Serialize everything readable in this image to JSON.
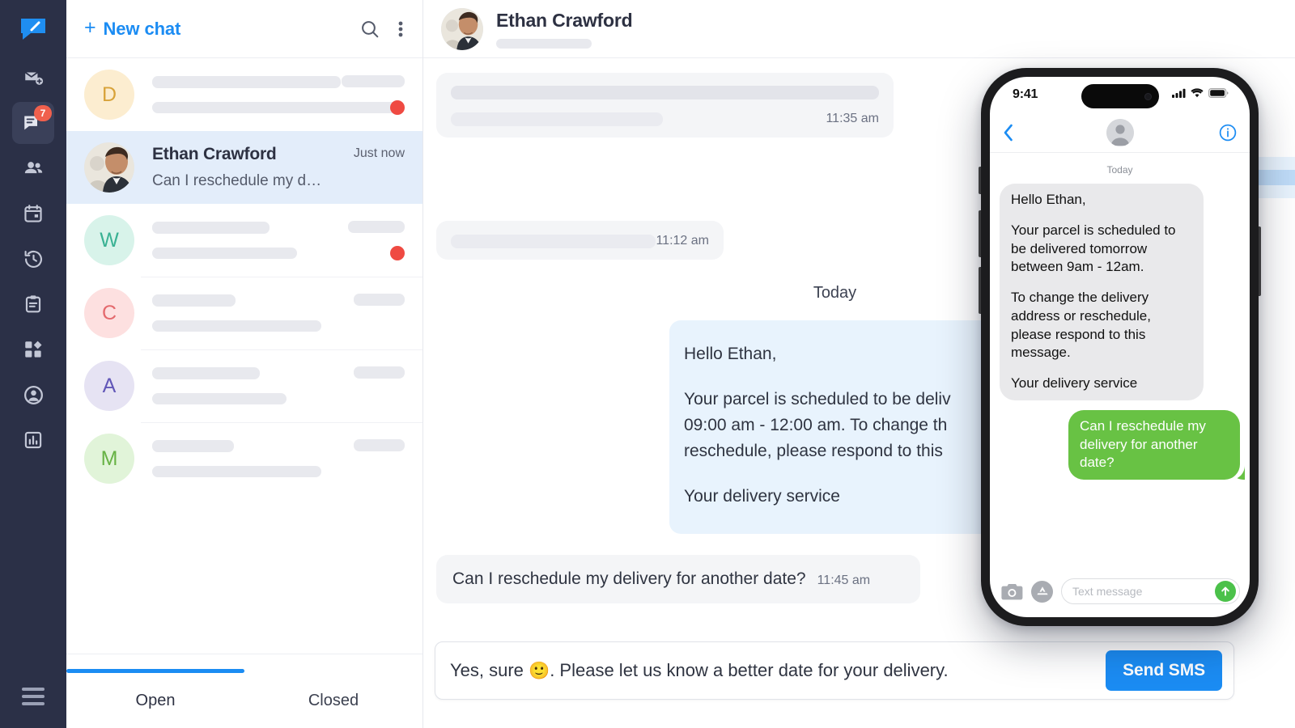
{
  "rail": {
    "logo_icon": "chat-logo-icon",
    "items": [
      {
        "icon": "mail-add-icon",
        "name": "new-message",
        "badge": null,
        "active": false
      },
      {
        "icon": "chat-bubbles-icon",
        "name": "conversations",
        "badge": "7",
        "active": true
      },
      {
        "icon": "contacts-icon",
        "name": "contacts",
        "badge": null,
        "active": false
      },
      {
        "icon": "calendar-icon",
        "name": "calendar",
        "badge": null,
        "active": false
      },
      {
        "icon": "history-icon",
        "name": "history",
        "badge": null,
        "active": false
      },
      {
        "icon": "clipboard-icon",
        "name": "tasks",
        "badge": null,
        "active": false
      },
      {
        "icon": "apps-grid-icon",
        "name": "apps",
        "badge": null,
        "active": false
      },
      {
        "icon": "account-icon",
        "name": "account",
        "badge": null,
        "active": false
      },
      {
        "icon": "reports-chart-icon",
        "name": "reports",
        "badge": null,
        "active": false
      }
    ],
    "menu_icon": "hamburger-menu-icon"
  },
  "list": {
    "new_chat_label": "New chat",
    "new_chat_plus": "+",
    "search_icon": "search-icon",
    "more_icon": "more-vertical-icon",
    "rows": [
      {
        "initial": "D",
        "bg": "#fcedd0",
        "fg": "#d8a33a",
        "placeholder": true,
        "unread": true
      },
      {
        "initial": "",
        "photo": true,
        "selected": true,
        "name": "Ethan Crawford",
        "preview": "Can I reschedule my delivery...",
        "time": "Just now",
        "placeholder": false,
        "unread": false
      },
      {
        "initial": "W",
        "bg": "#d8f3ea",
        "fg": "#39b193",
        "placeholder": true,
        "unread": true
      },
      {
        "initial": "C",
        "bg": "#fde0e0",
        "fg": "#e4696d",
        "placeholder": true,
        "unread": false
      },
      {
        "initial": "A",
        "bg": "#e6e3f3",
        "fg": "#6257b8",
        "placeholder": true,
        "unread": false
      },
      {
        "initial": "M",
        "bg": "#e1f4d9",
        "fg": "#67b245",
        "placeholder": true,
        "unread": false
      }
    ],
    "tabs": [
      {
        "label": "Open",
        "active": true
      },
      {
        "label": "Closed",
        "active": false
      }
    ]
  },
  "chat": {
    "contact_name": "Ethan Crawford",
    "messages": [
      {
        "type": "skeleton-in",
        "time": "11:35 am"
      },
      {
        "type": "skeleton-out",
        "time": ""
      },
      {
        "type": "skeleton-in-2",
        "time": "11:12 am"
      }
    ],
    "day_separator": "Today",
    "outgoing": {
      "line1": "Hello Ethan,",
      "line2": "Your parcel is scheduled to be deliv",
      "line3": "09:00 am - 12:00 am. To change th",
      "line4": "reschedule, please respond to this",
      "line5": "Your delivery service"
    },
    "incoming_last": {
      "text": "Can I reschedule my delivery for another date?",
      "time": "11:45 am"
    },
    "composer": {
      "value_before": "Yes, sure",
      "emoji": "🙂",
      "value_after": ".  Please let us know a better date for your delivery.",
      "send_label": "Send SMS"
    }
  },
  "phone": {
    "status": {
      "time": "9:41",
      "signal_icon": "cellular-signal-icon",
      "wifi_icon": "wifi-icon",
      "battery_icon": "battery-full-icon"
    },
    "nav": {
      "back_icon": "chevron-left-icon",
      "avatar_icon": "person-avatar-icon",
      "info_icon": "info-circle-icon"
    },
    "day_separator": "Today",
    "incoming": {
      "p1": "Hello Ethan,",
      "p2": "Your parcel is scheduled to be delivered tomorrow between 9am - 12am.",
      "p3": "To change the delivery address or reschedule, please respond to this message.",
      "p4": "Your delivery service"
    },
    "outgoing": "Can I reschedule my delivery for another date?",
    "bar": {
      "camera_icon": "camera-icon",
      "apps_icon": "app-store-icon",
      "input_placeholder": "Text message",
      "send_icon": "send-arrow-up-icon"
    }
  },
  "colors": {
    "rail_bg": "#2b3047",
    "accent_blue": "#1b8cf3",
    "badge_red": "#f0604d",
    "unread_red": "#ef4a42",
    "bubble_in": "#f4f5f7",
    "bubble_out": "#e8f3fd",
    "phone_green": "#68c244",
    "phone_gray": "#e9e9eb"
  }
}
